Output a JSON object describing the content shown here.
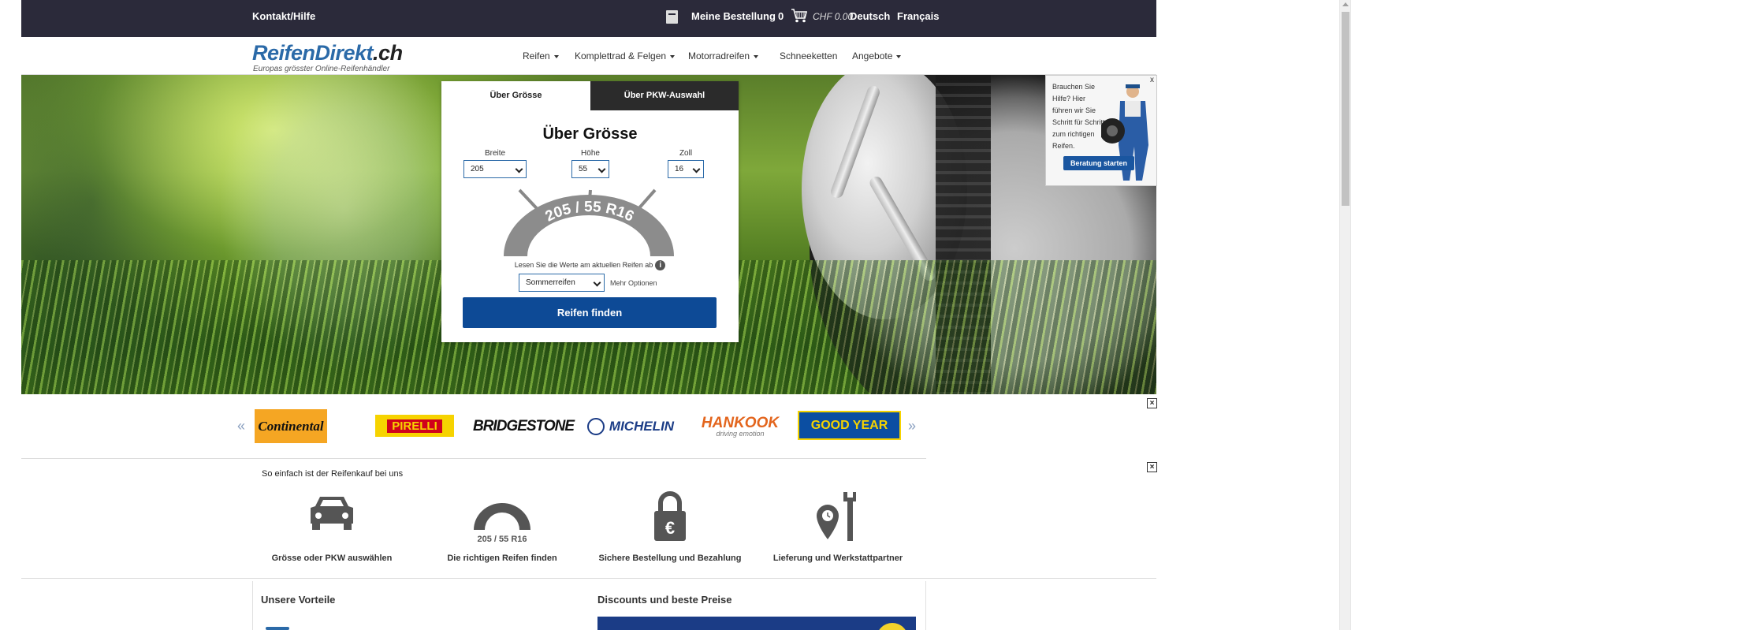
{
  "topbar": {
    "contact": "Kontakt/Hilfe",
    "order": "Meine Bestellung",
    "cart_count": "0",
    "cart_total": "CHF 0.00",
    "lang_de": "Deutsch",
    "lang_fr": "Français"
  },
  "header": {
    "logo_main": "ReifenDirekt",
    "logo_tld": ".ch",
    "tagline": "Europas grösster Online-Reifenhändler",
    "nav": [
      {
        "label": "Reifen"
      },
      {
        "label": "Komplettrad & Felgen"
      },
      {
        "label": "Motorradreifen"
      },
      {
        "label": "Schneeketten"
      },
      {
        "label": "Angebote"
      }
    ]
  },
  "search": {
    "tab_size": "Über Grösse",
    "tab_car": "Über PKW-Auswahl",
    "title": "Über Grösse",
    "width_label": "Breite",
    "height_label": "Höhe",
    "rim_label": "Zoll",
    "width_value": "205",
    "height_value": "55",
    "rim_value": "16",
    "tire_size_text": "205 / 55 R16",
    "hint": "Lesen Sie die Werte am aktuellen Reifen ab",
    "season_value": "Sommerreifen",
    "more_options": "Mehr Optionen",
    "find_button": "Reifen finden"
  },
  "help": {
    "text": "Brauchen Sie Hilfe? Hier führen wir Sie Schritt für Schritt zum richtigen Reifen.",
    "button": "Beratung starten",
    "close": "x"
  },
  "brands": {
    "items": [
      "Continental",
      "PIRELLI",
      "BRIDGESTONE",
      "MICHELIN",
      "HANKOOK",
      "GOOD YEAR"
    ],
    "hankook_sub": "driving emotion",
    "close": "×"
  },
  "steps": {
    "title": "So einfach ist der Reifenkauf bei uns",
    "items": [
      {
        "label": "Grösse oder PKW auswählen",
        "icon": "car-icon"
      },
      {
        "label": "Die richtigen Reifen finden",
        "icon": "tire-size-icon"
      },
      {
        "label": "Sichere Bestellung und Bezahlung",
        "icon": "lock-euro-icon"
      },
      {
        "label": "Lieferung und Werkstattpartner",
        "icon": "location-wrench-icon"
      }
    ],
    "tire_icon_text": "205 / 55 R16",
    "close": "×"
  },
  "cards": {
    "vorteile": "Unsere Vorteile",
    "discounts": "Discounts und beste Preise"
  },
  "colors": {
    "topbar": "#2b2a3a",
    "brand_blue": "#2b6aa8",
    "button_blue": "#0d4a96"
  }
}
